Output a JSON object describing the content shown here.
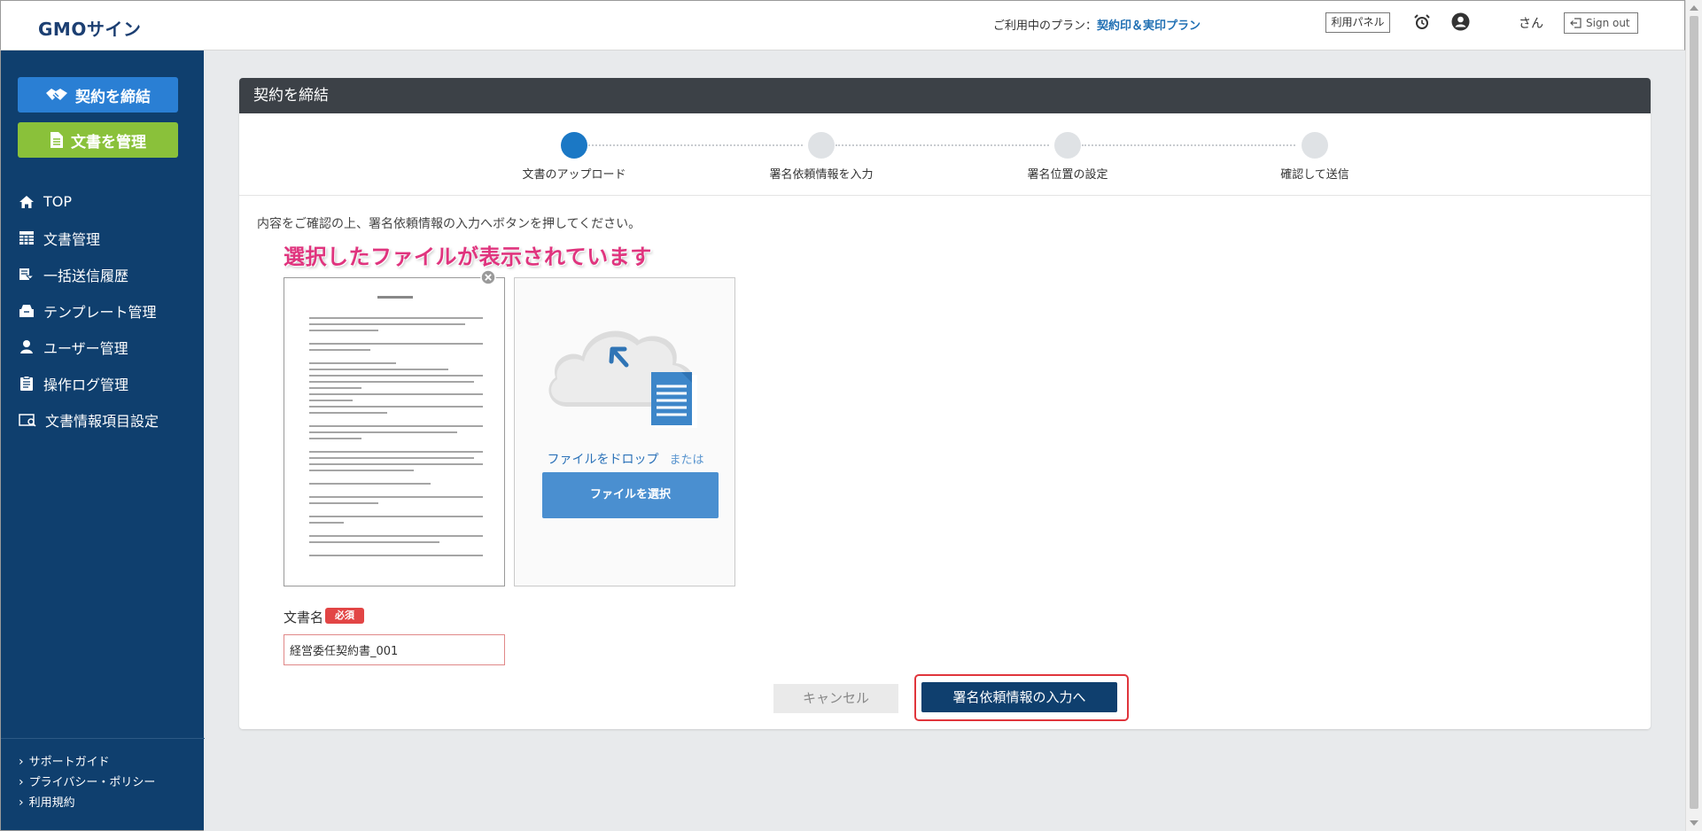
{
  "header": {
    "logo": "GMOサイン",
    "plan_prefix": "ご利用中のプラン：",
    "plan_name": "契約印＆実印プラン",
    "panel_label": "利用パネル",
    "username": "さん",
    "signout_label": "Sign out"
  },
  "sidebar": {
    "contract_button": "契約を締結",
    "manage_button": "文書を管理",
    "nav": [
      {
        "label": "TOP",
        "icon": "home-icon"
      },
      {
        "label": "文書管理",
        "icon": "grid-icon"
      },
      {
        "label": "一括送信履歴",
        "icon": "bulk-send-icon"
      },
      {
        "label": "テンプレート管理",
        "icon": "template-icon"
      },
      {
        "label": "ユーザー管理",
        "icon": "user-icon"
      },
      {
        "label": "操作ログ管理",
        "icon": "log-icon"
      },
      {
        "label": "文書情報項目設定",
        "icon": "doc-info-icon"
      }
    ],
    "footer_links": [
      "サポートガイド",
      "プライバシー・ポリシー",
      "利用規約"
    ]
  },
  "main": {
    "title": "契約を締結",
    "steps": [
      {
        "label": "文書のアップロード",
        "active": true
      },
      {
        "label": "署名依頼情報を入力",
        "active": false
      },
      {
        "label": "署名位置の設定",
        "active": false
      },
      {
        "label": "確認して送信",
        "active": false
      }
    ],
    "instruction": "内容をご確認の上、署名依頼情報の入力へボタンを押してください。",
    "callout": "選択したファイルが表示されています",
    "upload": {
      "drop_text": "ファイルをドロップ",
      "or_text": "または",
      "select_button": "ファイルを選択"
    },
    "document_name_label": "文書名",
    "required_badge": "必須",
    "document_name_value": "経営委任契約書_001",
    "cancel_button": "キャンセル",
    "next_button": "署名依頼情報の入力へ"
  },
  "colors": {
    "sidebar_bg": "#0f3f6e",
    "accent_blue": "#1b78c5",
    "manage_green": "#8ac13a",
    "highlight_red": "#e0353c",
    "callout_pink": "#e0347e"
  }
}
